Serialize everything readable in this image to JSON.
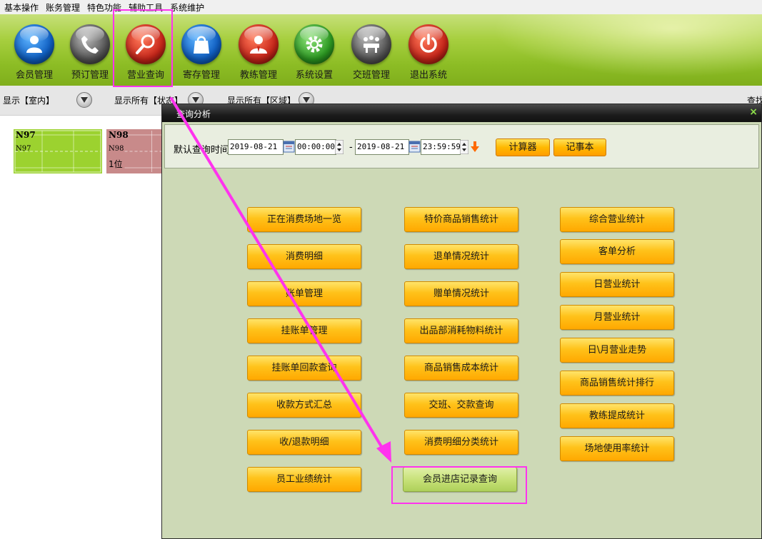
{
  "menubar": {
    "items": [
      "基本操作",
      "账务管理",
      "特色功能",
      "辅助工具",
      "系统维护"
    ]
  },
  "toolbar": {
    "buttons": [
      {
        "label": "会员管理",
        "icon": "user-icon"
      },
      {
        "label": "预订管理",
        "icon": "phone-icon"
      },
      {
        "label": "营业查询",
        "icon": "magnifier-icon"
      },
      {
        "label": "寄存管理",
        "icon": "bag-icon"
      },
      {
        "label": "教练管理",
        "icon": "coach-icon"
      },
      {
        "label": "系统设置",
        "icon": "gear-icon"
      },
      {
        "label": "交班管理",
        "icon": "meeting-icon"
      },
      {
        "label": "退出系统",
        "icon": "power-icon"
      }
    ]
  },
  "filterbar": {
    "filter1": "显示【室内】",
    "filter2": "显示所有【状态】",
    "filter3": "显示所有【区域】",
    "filter4": "查找"
  },
  "courts": [
    {
      "name": "N97",
      "sub": "N97",
      "extra": "",
      "color": "#9cd22f"
    },
    {
      "name": "N98",
      "sub": "N98",
      "extra": "1位",
      "color": "#c88a8a"
    }
  ],
  "dialog": {
    "title": "查询分析",
    "close": "×",
    "query_label": "默认查询时间",
    "start_date": "2019-08-21",
    "start_time": "00:00:00",
    "dash": "-",
    "end_date": "2019-08-21",
    "end_time": "23:59:59",
    "calculator": "计算器",
    "notepad": "记事本",
    "col1": [
      "正在消费场地一览",
      "消费明细",
      "账单管理",
      "挂账单管理",
      "挂账单回款查询",
      "收款方式汇总",
      "收/退款明细",
      "员工业绩统计"
    ],
    "col2": [
      "特价商品销售统计",
      "退单情况统计",
      "赠单情况统计",
      "出品部消耗物料统计",
      "商品销售成本统计",
      "交班、交款查询",
      "消费明细分类统计",
      "会员进店记录查询"
    ],
    "col3": [
      "综合营业统计",
      "客单分析",
      "日营业统计",
      "月营业统计",
      "日\\月营业走势",
      "商品销售统计排行",
      "教练提成统计",
      "场地使用率统计"
    ]
  },
  "colors": {
    "accent_highlight": "#ff33ee",
    "button_orange": "#ffb800",
    "button_active_green": "#c8e27a",
    "dialog_bg": "#cdd9b6"
  }
}
